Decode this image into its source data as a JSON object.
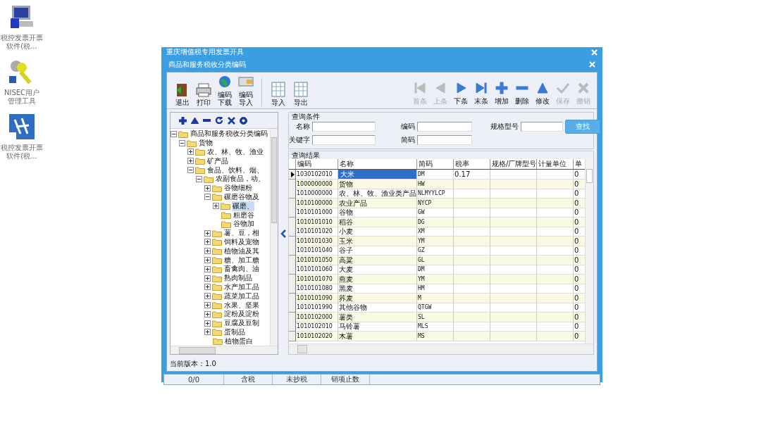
{
  "desktop_icons": [
    {
      "label": "税控发票开票软件(税..."
    },
    {
      "label": "NISEC用户管理工具"
    },
    {
      "label": "税控发票开票软件(税..."
    }
  ],
  "outer_window": {
    "title": "重庆增值税专用发票开具",
    "status_bar": [
      "0/0",
      "含税",
      "未抄税",
      "销项止数"
    ]
  },
  "window": {
    "title": "商品和服务税收分类编码",
    "toolbar_left": [
      {
        "label": "退出"
      },
      {
        "label": "打印"
      },
      {
        "label": "编码下载"
      },
      {
        "label": "编码导入"
      }
    ],
    "toolbar_mid": [
      {
        "label": "导入"
      },
      {
        "label": "导出"
      }
    ],
    "toolbar_right": [
      {
        "label": "首条",
        "disabled": true
      },
      {
        "label": "上条",
        "disabled": true
      },
      {
        "label": "下条",
        "disabled": false
      },
      {
        "label": "末条",
        "disabled": false
      },
      {
        "label": "增加",
        "disabled": false
      },
      {
        "label": "删除",
        "disabled": false
      },
      {
        "label": "修改",
        "disabled": false
      },
      {
        "label": "保存",
        "disabled": true
      },
      {
        "label": "撤销",
        "disabled": true
      }
    ],
    "tree": [
      {
        "label": "商品和服务税收分类编码",
        "kind": "branch",
        "expanded": true,
        "selected": false,
        "children": [
          {
            "label": "货物",
            "kind": "branch",
            "expanded": true,
            "selected": false,
            "children": [
              {
                "label": "农、林、牧、渔业",
                "kind": "branch",
                "expanded": false,
                "selected": false
              },
              {
                "label": "矿产品",
                "kind": "branch",
                "expanded": false,
                "selected": false
              },
              {
                "label": "食品、饮料、烟、",
                "kind": "branch",
                "expanded": true,
                "selected": false,
                "children": [
                  {
                    "label": "农副食品，动、",
                    "kind": "branch",
                    "expanded": true,
                    "selected": false,
                    "children": [
                      {
                        "label": "谷物细粉",
                        "kind": "branch",
                        "expanded": false,
                        "selected": false
                      },
                      {
                        "label": "碾磨谷物及",
                        "kind": "branch",
                        "expanded": true,
                        "selected": false,
                        "children": [
                          {
                            "label": "碾磨、",
                            "kind": "branch",
                            "expanded": false,
                            "selected": true
                          },
                          {
                            "label": "粗磨谷",
                            "kind": "leaf",
                            "selected": false
                          },
                          {
                            "label": "谷物加",
                            "kind": "leaf",
                            "selected": false
                          }
                        ]
                      },
                      {
                        "label": "薯、豆，相",
                        "kind": "branch",
                        "expanded": false,
                        "selected": false
                      },
                      {
                        "label": "饲料及宠物",
                        "kind": "branch",
                        "expanded": false,
                        "selected": false
                      },
                      {
                        "label": "植物油及其",
                        "kind": "branch",
                        "expanded": false,
                        "selected": false
                      },
                      {
                        "label": "糖、加工糖",
                        "kind": "branch",
                        "expanded": false,
                        "selected": false
                      },
                      {
                        "label": "畜禽肉、油",
                        "kind": "branch",
                        "expanded": false,
                        "selected": false
                      },
                      {
                        "label": "熟肉制品",
                        "kind": "branch",
                        "expanded": false,
                        "selected": false
                      },
                      {
                        "label": "水产加工品",
                        "kind": "branch",
                        "expanded": false,
                        "selected": false
                      },
                      {
                        "label": "蔬菜加工品",
                        "kind": "branch",
                        "expanded": false,
                        "selected": false
                      },
                      {
                        "label": "水果、坚果",
                        "kind": "branch",
                        "expanded": false,
                        "selected": false
                      },
                      {
                        "label": "淀粉及淀粉",
                        "kind": "branch",
                        "expanded": false,
                        "selected": false
                      },
                      {
                        "label": "豆腐及豆制",
                        "kind": "branch",
                        "expanded": false,
                        "selected": false
                      },
                      {
                        "label": "蛋制品",
                        "kind": "branch",
                        "expanded": false,
                        "selected": false
                      },
                      {
                        "label": "植物蛋白",
                        "kind": "leaf",
                        "selected": false
                      }
                    ]
                  }
                ]
              }
            ]
          }
        ]
      }
    ],
    "query": {
      "title": "查询条件",
      "fields": [
        {
          "label": "名称"
        },
        {
          "label": "编码"
        },
        {
          "label": "规格型号"
        },
        {
          "label": "关键字"
        },
        {
          "label": "简码"
        }
      ],
      "button": "查找"
    },
    "results": {
      "title": "查询结果",
      "columns": [
        "编码",
        "名称",
        "简码",
        "税率",
        "规格/厂牌型号",
        "计量单位",
        "单"
      ],
      "rows": [
        {
          "selected": true,
          "cells": [
            "1030102010",
            "大米",
            "DM",
            "0.17",
            "",
            "",
            "0"
          ]
        },
        {
          "selected": false,
          "cells": [
            "1000000000",
            "货物",
            "HW",
            "",
            "",
            "",
            "0"
          ]
        },
        {
          "selected": false,
          "cells": [
            "1010000000",
            "农、林、牧、渔业类产品",
            "NLMYYLCP",
            "",
            "",
            "",
            "0"
          ]
        },
        {
          "selected": false,
          "cells": [
            "1010100000",
            "农业产品",
            "NYCP",
            "",
            "",
            "",
            "0"
          ]
        },
        {
          "selected": false,
          "cells": [
            "1010101000",
            "谷物",
            "GW",
            "",
            "",
            "",
            "0"
          ]
        },
        {
          "selected": false,
          "cells": [
            "1010101010",
            "稻谷",
            "DG",
            "",
            "",
            "",
            "0"
          ]
        },
        {
          "selected": false,
          "cells": [
            "1010101020",
            "小麦",
            "XM",
            "",
            "",
            "",
            "0"
          ]
        },
        {
          "selected": false,
          "cells": [
            "1010101030",
            "玉米",
            "YM",
            "",
            "",
            "",
            "0"
          ]
        },
        {
          "selected": false,
          "cells": [
            "1010101040",
            "谷子",
            "GZ",
            "",
            "",
            "",
            "0"
          ]
        },
        {
          "selected": false,
          "cells": [
            "1010101050",
            "高粱",
            "GL",
            "",
            "",
            "",
            "0"
          ]
        },
        {
          "selected": false,
          "cells": [
            "1010101060",
            "大麦",
            "DM",
            "",
            "",
            "",
            "0"
          ]
        },
        {
          "selected": false,
          "cells": [
            "1010101070",
            "燕麦",
            "YM",
            "",
            "",
            "",
            "0"
          ]
        },
        {
          "selected": false,
          "cells": [
            "1010101080",
            "黑麦",
            "HM",
            "",
            "",
            "",
            "0"
          ]
        },
        {
          "selected": false,
          "cells": [
            "1010101090",
            "荞麦",
            "M",
            "",
            "",
            "",
            "0"
          ]
        },
        {
          "selected": false,
          "cells": [
            "1010101990",
            "其他谷物",
            "QTGW",
            "",
            "",
            "",
            "0"
          ]
        },
        {
          "selected": false,
          "cells": [
            "1010102000",
            "薯类",
            "SL",
            "",
            "",
            "",
            "0"
          ]
        },
        {
          "selected": false,
          "cells": [
            "1010102010",
            "马铃薯",
            "MLS",
            "",
            "",
            "",
            "0"
          ]
        },
        {
          "selected": false,
          "cells": [
            "1010102020",
            "木薯",
            "MS",
            "",
            "",
            "",
            "0"
          ]
        }
      ]
    },
    "version": "当前版本：1.0"
  }
}
